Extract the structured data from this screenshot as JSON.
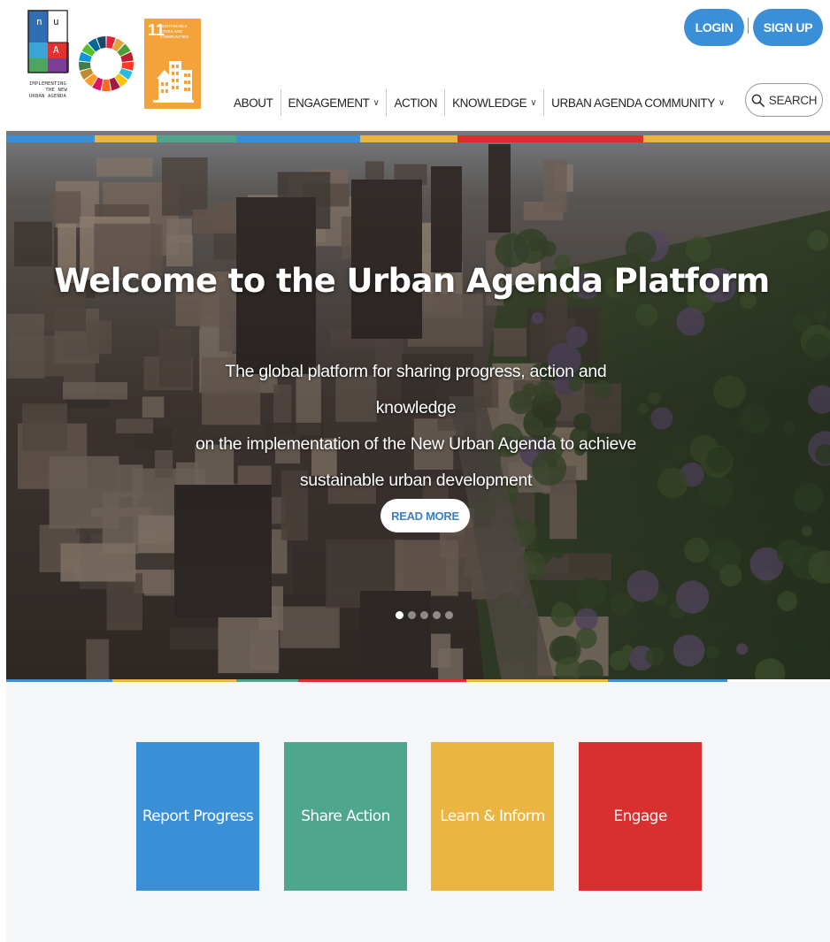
{
  "header": {
    "nua_logo_text": [
      "IMPLEMENTING",
      "THE NEW",
      "URBAN AGENDA"
    ],
    "sdg11": {
      "number": "11",
      "label": "SUSTAINABLE CITIES AND COMMUNITIES"
    },
    "login_label": "LOGIN",
    "signup_label": "SIGN UP",
    "search_label": "SEARCH",
    "nav": [
      {
        "label": "ABOUT",
        "has_dropdown": false
      },
      {
        "label": "ENGAGEMENT",
        "has_dropdown": true
      },
      {
        "label": "ACTION",
        "has_dropdown": false
      },
      {
        "label": "KNOWLEDGE",
        "has_dropdown": true
      },
      {
        "label": "URBAN AGENDA COMMUNITY",
        "has_dropdown": true
      }
    ],
    "chevron_glyph": "∨"
  },
  "hero": {
    "title": "Welcome to the Urban Agenda Platform",
    "subtitle_lines": [
      "The global platform for sharing progress, action and knowledge",
      "on the implementation of the New Urban Agenda to achieve",
      "sustainable urban development"
    ],
    "read_more_label": "READ MORE",
    "slides_total": 5,
    "active_slide": 1
  },
  "cards": [
    {
      "label": "Report Progress",
      "color": "#3b8fd6"
    },
    {
      "label": "Share Action",
      "color": "#4ea68d"
    },
    {
      "label": "Learn & Inform",
      "color": "#ebb542"
    },
    {
      "label": "Engage",
      "color": "#d9302f"
    }
  ],
  "colors": {
    "accent_blue": "#3b8fd6",
    "green": "#4ea68d",
    "yellow": "#ebb542",
    "red": "#d9302f",
    "sdg11_orange": "#f3a33a"
  },
  "icons": {
    "search": "magnifier-icon",
    "dropdown": "chevron-down-icon"
  }
}
